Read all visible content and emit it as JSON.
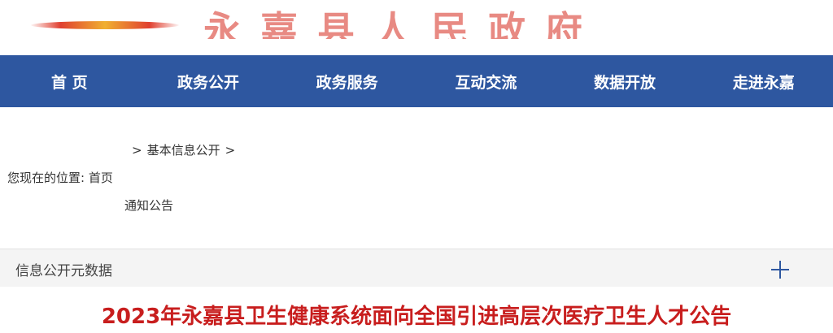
{
  "header": {
    "site_title": "永嘉县人民政府"
  },
  "nav": {
    "items": [
      {
        "label": "首 页"
      },
      {
        "label": "政务公开"
      },
      {
        "label": "政务服务"
      },
      {
        "label": "互动交流"
      },
      {
        "label": "数据开放"
      },
      {
        "label": "走进永嘉"
      }
    ]
  },
  "breadcrumb": {
    "prefix": "您现在的位置:",
    "home": "首页",
    "separator": ">",
    "level1": "基本信息公开",
    "level2": "通知公告"
  },
  "metadata_panel": {
    "label": "信息公开元数据"
  },
  "article": {
    "title": "2023年永嘉县卫生健康系统面向全国引进高层次医疗卫生人才公告"
  },
  "colors": {
    "nav_background": "#2e57a0",
    "title_red": "#c81e1e",
    "panel_background": "#f4f4f4"
  }
}
